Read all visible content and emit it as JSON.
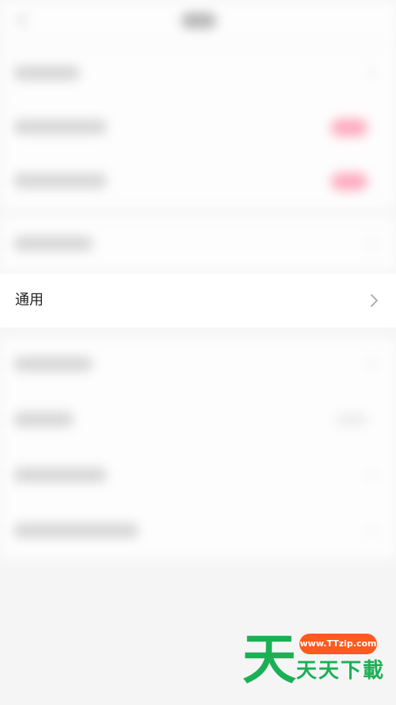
{
  "general_row": {
    "label": "通用",
    "icon": "chevron-right-icon"
  },
  "watermark": {
    "url": "www.TTzip.com",
    "brand": "天天下載",
    "logo_char": "天"
  },
  "colors": {
    "background": "#f5f5f6",
    "row_background": "#ffffff",
    "text": "#222222",
    "chevron": "#a8a8a8",
    "toggle_on": "#ff99b2",
    "watermark_green": "#1bb055",
    "watermark_orange": "#ff5a1f"
  }
}
